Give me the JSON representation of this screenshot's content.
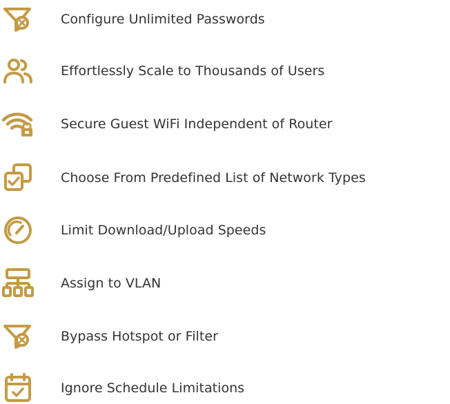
{
  "accent_color": "#C49A45",
  "text_color": "#333333",
  "features": [
    {
      "label": "Configure Unlimited Passwords",
      "icon": "filter-x-icon"
    },
    {
      "label": "Effortlessly Scale to Thousands of Users",
      "icon": "users-icon"
    },
    {
      "label": "Secure Guest WiFi Independent of Router",
      "icon": "wifi-lock-icon"
    },
    {
      "label": "Choose From Predefined List of Network Types",
      "icon": "copy-check-icon"
    },
    {
      "label": "Limit Download/Upload Speeds",
      "icon": "speedometer-icon"
    },
    {
      "label": "Assign to VLAN",
      "icon": "network-hierarchy-icon"
    },
    {
      "label": "Bypass Hotspot or Filter",
      "icon": "filter-x-icon"
    },
    {
      "label": "Ignore Schedule Limitations",
      "icon": "calendar-check-icon"
    }
  ]
}
